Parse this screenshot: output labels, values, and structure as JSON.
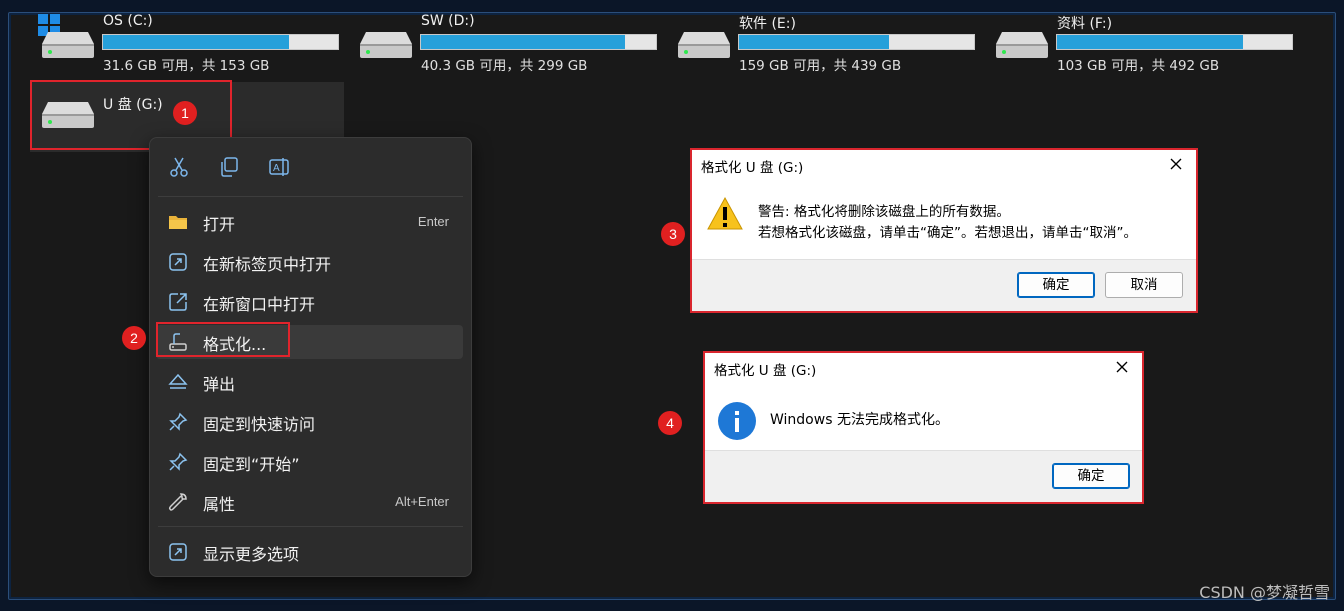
{
  "drives": [
    {
      "name": "OS (C:)",
      "usage_text": "31.6 GB 可用，共 153 GB",
      "used_fraction": 0.79
    },
    {
      "name": "SW (D:)",
      "usage_text": "40.3 GB 可用，共 299 GB",
      "used_fraction": 0.87
    },
    {
      "name": "软件 (E:)",
      "usage_text": "159 GB 可用，共 439 GB",
      "used_fraction": 0.64
    },
    {
      "name": "资料 (F:)",
      "usage_text": "103 GB 可用，共 492 GB",
      "used_fraction": 0.79
    }
  ],
  "usb_drive": {
    "name": "U 盘 (G:)"
  },
  "steps": [
    "1",
    "2",
    "3",
    "4"
  ],
  "context_menu": {
    "quick_actions": [
      "cut-icon",
      "copy-icon",
      "rename-icon"
    ],
    "items": [
      {
        "label": "打开",
        "shortcut": "Enter",
        "icon": "folder-icon"
      },
      {
        "label": "在新标签页中打开",
        "shortcut": "",
        "icon": "open-new-tab-icon"
      },
      {
        "label": "在新窗口中打开",
        "shortcut": "",
        "icon": "open-new-window-icon"
      },
      {
        "label": "格式化...",
        "shortcut": "",
        "icon": "format-icon"
      },
      {
        "label": "弹出",
        "shortcut": "",
        "icon": "eject-icon"
      },
      {
        "label": "固定到快速访问",
        "shortcut": "",
        "icon": "pin-icon"
      },
      {
        "label": "固定到“开始”",
        "shortcut": "",
        "icon": "pin-start-icon"
      },
      {
        "label": "属性",
        "shortcut": "Alt+Enter",
        "icon": "wrench-icon"
      },
      {
        "label": "显示更多选项",
        "shortcut": "",
        "icon": "more-options-icon"
      }
    ]
  },
  "warning_dialog": {
    "title": "格式化 U 盘 (G:)",
    "line1": "警告: 格式化将删除该磁盘上的所有数据。",
    "line2": "若想格式化该磁盘，请单击“确定”。若想退出，请单击“取消”。",
    "ok_label": "确定",
    "cancel_label": "取消"
  },
  "result_dialog": {
    "title": "格式化 U 盘 (G:)",
    "message": "Windows 无法完成格式化。",
    "ok_label": "确定"
  },
  "watermark": "CSDN @梦凝哲雪",
  "colors": {
    "accent": "#26a0da",
    "highlight_red": "#e0242c",
    "menu_bg": "#2c2c2c"
  }
}
